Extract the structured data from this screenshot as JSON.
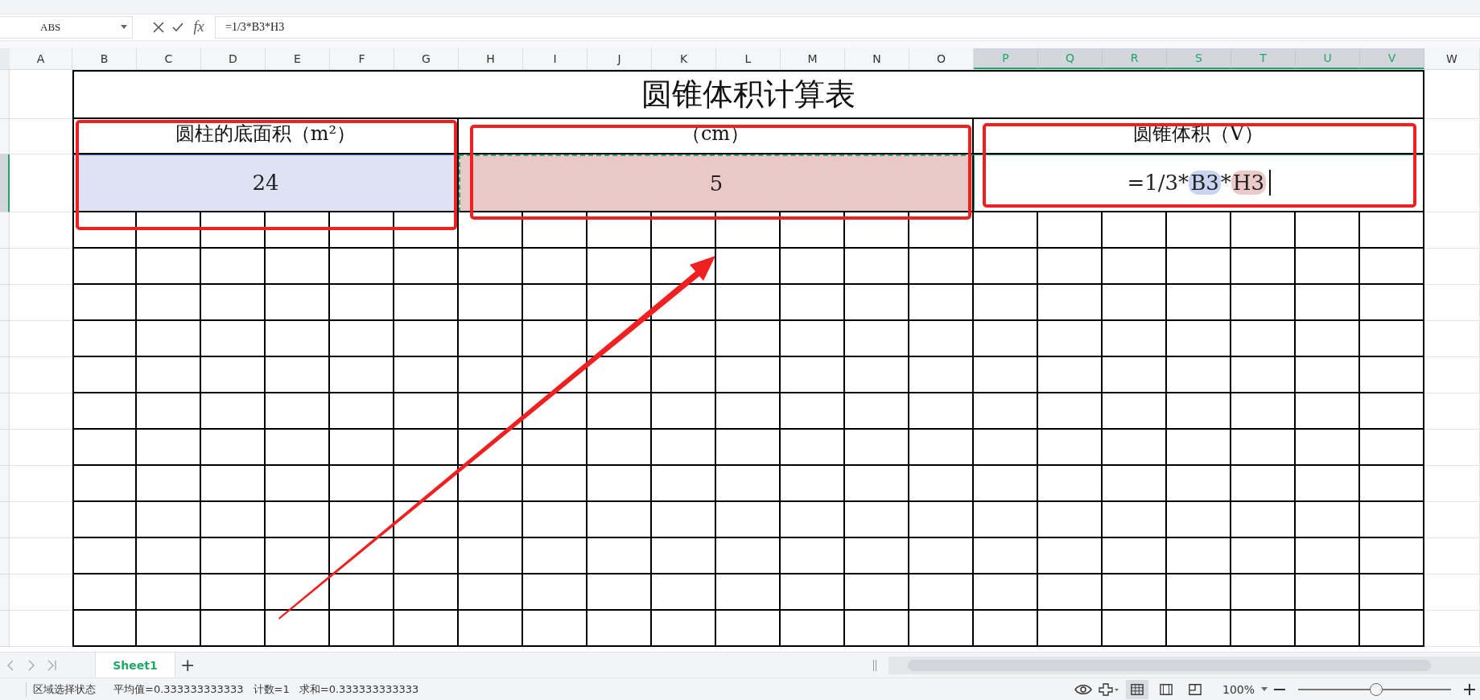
{
  "name_box": "ABS",
  "formula_bar": {
    "fx": "fx",
    "formula": "=1/3*B3*H3"
  },
  "columns": [
    {
      "label": "A",
      "selected": false
    },
    {
      "label": "B",
      "selected": false
    },
    {
      "label": "C",
      "selected": false
    },
    {
      "label": "D",
      "selected": false
    },
    {
      "label": "E",
      "selected": false
    },
    {
      "label": "F",
      "selected": false
    },
    {
      "label": "G",
      "selected": false
    },
    {
      "label": "H",
      "selected": false
    },
    {
      "label": "I",
      "selected": false
    },
    {
      "label": "J",
      "selected": false
    },
    {
      "label": "K",
      "selected": false
    },
    {
      "label": "L",
      "selected": false
    },
    {
      "label": "M",
      "selected": false
    },
    {
      "label": "N",
      "selected": false
    },
    {
      "label": "O",
      "selected": false
    },
    {
      "label": "P",
      "selected": true
    },
    {
      "label": "Q",
      "selected": true
    },
    {
      "label": "R",
      "selected": true
    },
    {
      "label": "S",
      "selected": true
    },
    {
      "label": "T",
      "selected": true
    },
    {
      "label": "U",
      "selected": true
    },
    {
      "label": "V",
      "selected": true
    },
    {
      "label": "W",
      "selected": false
    }
  ],
  "sheet": {
    "title": "圆锥体积计算表",
    "headers": [
      "圆柱的底面积（m²）",
      "（cm）",
      "圆锥体积（V）"
    ],
    "values": [
      {
        "kind": "value",
        "text": "24",
        "color": "#dde3f4"
      },
      {
        "kind": "value",
        "text": "5",
        "color": "#ebc8c8"
      },
      {
        "kind": "formula",
        "parts": [
          {
            "text": "=1/3*"
          },
          {
            "text": "B3",
            "color": "#c9d4f1"
          },
          {
            "text": "*"
          },
          {
            "text": "H3",
            "color": "#edcaca"
          }
        ]
      }
    ]
  },
  "sheet_tabs": [
    {
      "label": "Sheet1",
      "selected": true
    }
  ],
  "add_sheet": "+",
  "status_bar": {
    "mode": "区域选择状态",
    "stats": [
      "平均值=0.333333333333",
      "计数=1",
      "求和=0.333333333333"
    ],
    "zoom": "100%",
    "zoom_level": {
      "level": 0.51
    },
    "views": [
      {
        "kind": "normal",
        "selected": true
      },
      {
        "kind": "page",
        "selected": false
      },
      {
        "kind": "break",
        "selected": false
      }
    ]
  }
}
